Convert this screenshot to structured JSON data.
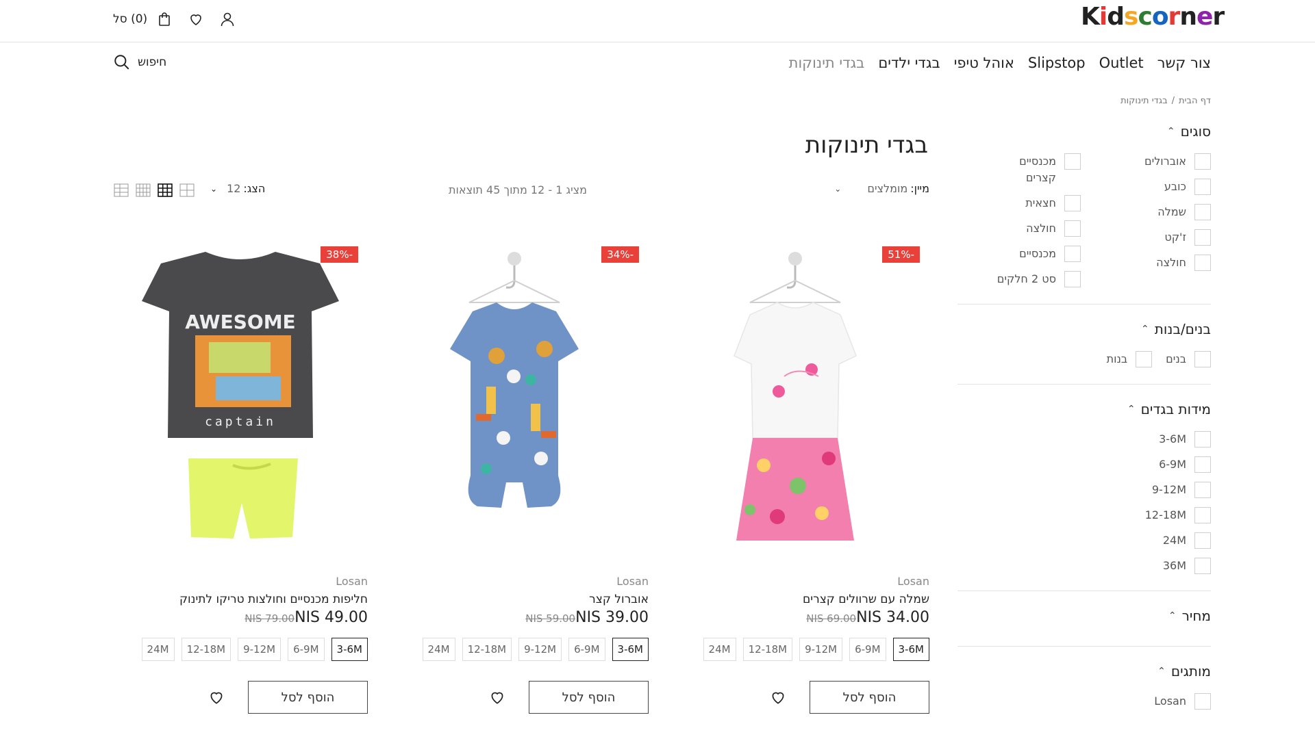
{
  "header": {
    "logo_letters": [
      "K",
      "i",
      "d",
      "s",
      "c",
      "o",
      "r",
      "n",
      "e",
      "r"
    ],
    "logo_colors": [
      "#222222",
      "#e53935",
      "#222222",
      "#f5a623",
      "#2e7d32",
      "#1565c0",
      "#e53935",
      "#222222",
      "#8e24aa",
      "#222222"
    ],
    "cart_label": "סל",
    "cart_count": "(0)",
    "icons": [
      "bag-icon",
      "heart-icon",
      "user-icon"
    ]
  },
  "nav": {
    "items": [
      "בגדי תינוקות",
      "בגדי ילדים",
      "אוהל טיפי",
      "Slipstop",
      "Outlet",
      "צור קשר"
    ],
    "search_label": "חיפוש"
  },
  "breadcrumb": {
    "home": "דף הבית",
    "sep": "/",
    "current": "בגדי תינוקות"
  },
  "page": {
    "title": "בגדי תינוקות"
  },
  "toolbar": {
    "sort_label": "מיין:",
    "sort_value": "מומלצים",
    "results": "מציג 1 - 12 מתוך 45 תוצאות",
    "show_label": "הצג:",
    "show_value": "12"
  },
  "filters": {
    "types": {
      "title": "סוגים",
      "col1": [
        "אוברולים",
        "כובע",
        "שמלה",
        "ז'קט",
        "חולצה"
      ],
      "col2": [
        "מכנסיים קצרים",
        "חצאית",
        "חולצה",
        "מכנסיים",
        "סט 2 חלקים"
      ]
    },
    "gender": {
      "title": "בנים/בנות",
      "items": [
        "בנים",
        "בנות"
      ]
    },
    "sizes": {
      "title": "מידות בגדים",
      "items": [
        "3-6M",
        "6-9M",
        "9-12M",
        "12-18M",
        "24M",
        "36M"
      ]
    },
    "price": {
      "title": "מחיר"
    },
    "brands": {
      "title": "מותגים",
      "items": [
        "Losan"
      ]
    }
  },
  "products": [
    {
      "badge": "51%-",
      "brand": "Losan",
      "name": "שמלה עם שרוולים קצרים",
      "price": "NIS 34.00",
      "old_price": "NIS 69.00",
      "sizes": [
        "3-6M",
        "6-9M",
        "9-12M",
        "12-18M",
        "24M"
      ],
      "selected_size": "3-6M",
      "add_label": "הוסף לסל",
      "image": "dress-illustration"
    },
    {
      "badge": "34%-",
      "brand": "Losan",
      "name": "אוברול קצר",
      "price": "NIS 39.00",
      "old_price": "NIS 59.00",
      "sizes": [
        "3-6M",
        "6-9M",
        "9-12M",
        "12-18M",
        "24M"
      ],
      "selected_size": "3-6M",
      "add_label": "הוסף לסל",
      "image": "romper-illustration"
    },
    {
      "badge": "38%-",
      "brand": "Losan",
      "name": "חליפות מכנסיים וחולצות טריקו לתינוק",
      "price": "NIS 49.00",
      "old_price": "NIS 79.00",
      "sizes": [
        "3-6M",
        "6-9M",
        "9-12M",
        "12-18M",
        "24M"
      ],
      "selected_size": "3-6M",
      "add_label": "הוסף לסל",
      "image": "tshirt-shorts-illustration",
      "shirt_text_1": "AWESOME",
      "shirt_text_2": "captain"
    }
  ]
}
